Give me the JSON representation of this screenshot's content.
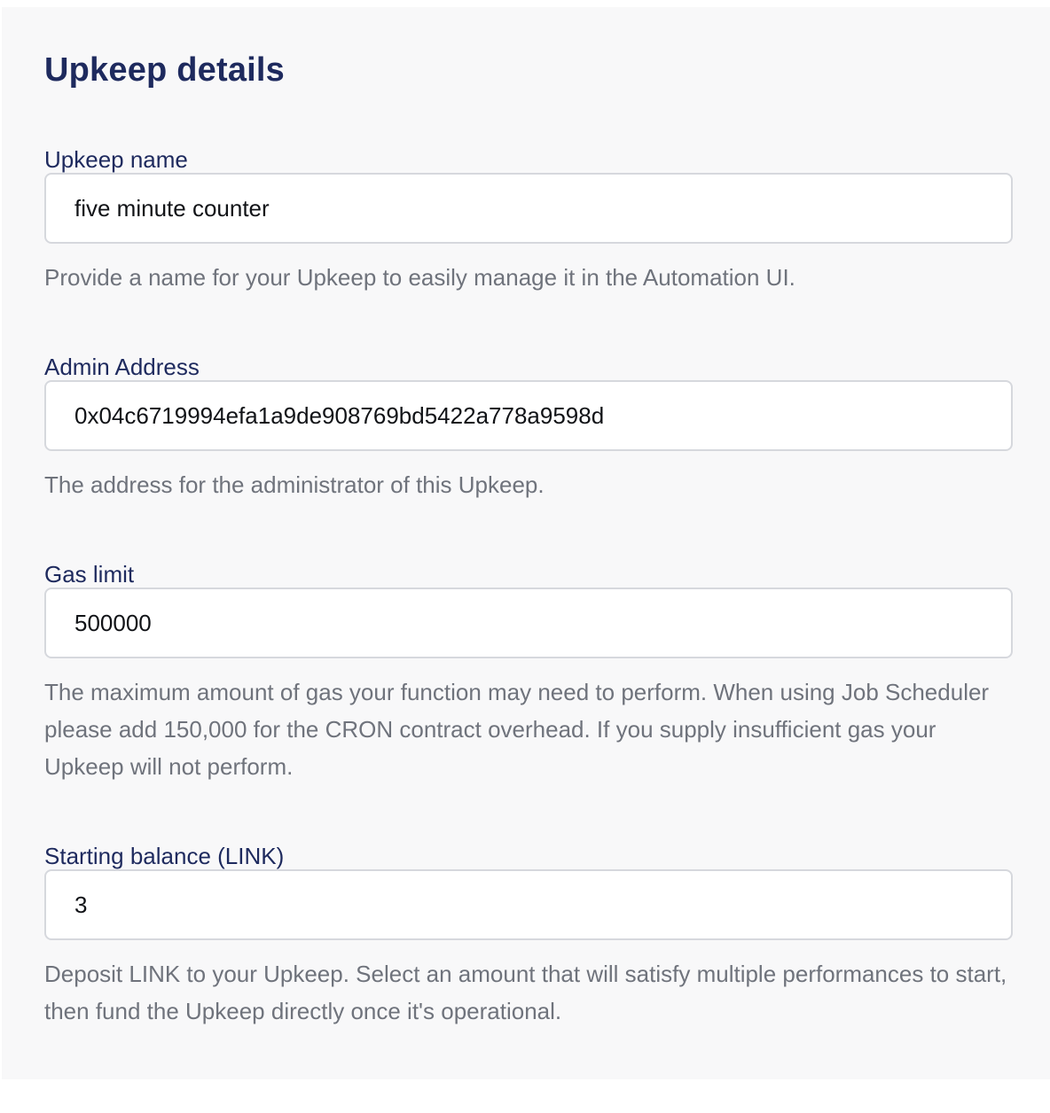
{
  "section": {
    "title": "Upkeep details"
  },
  "fields": {
    "upkeep_name": {
      "label": "Upkeep name",
      "value": "five minute counter",
      "help": "Provide a name for your Upkeep to easily manage it in the Automation UI."
    },
    "admin_address": {
      "label": "Admin Address",
      "value": "0x04c6719994efa1a9de908769bd5422a778a9598d",
      "help": "The address for the administrator of this Upkeep."
    },
    "gas_limit": {
      "label": "Gas limit",
      "value": "500000",
      "help": "The maximum amount of gas your function may need to perform. When using Job Scheduler please add 150,000 for the CRON contract overhead. If you supply insufficient gas your Upkeep will not perform."
    },
    "starting_balance": {
      "label": "Starting balance (LINK)",
      "value": "3",
      "help": "Deposit LINK to your Upkeep. Select an amount that will satisfy multiple performances to start, then fund the Upkeep directly once it's operational."
    }
  },
  "colors": {
    "heading": "#1e2a5e",
    "help_text": "#6f737c",
    "panel_background": "#f8f8f9",
    "input_border": "#d6d8dd"
  }
}
